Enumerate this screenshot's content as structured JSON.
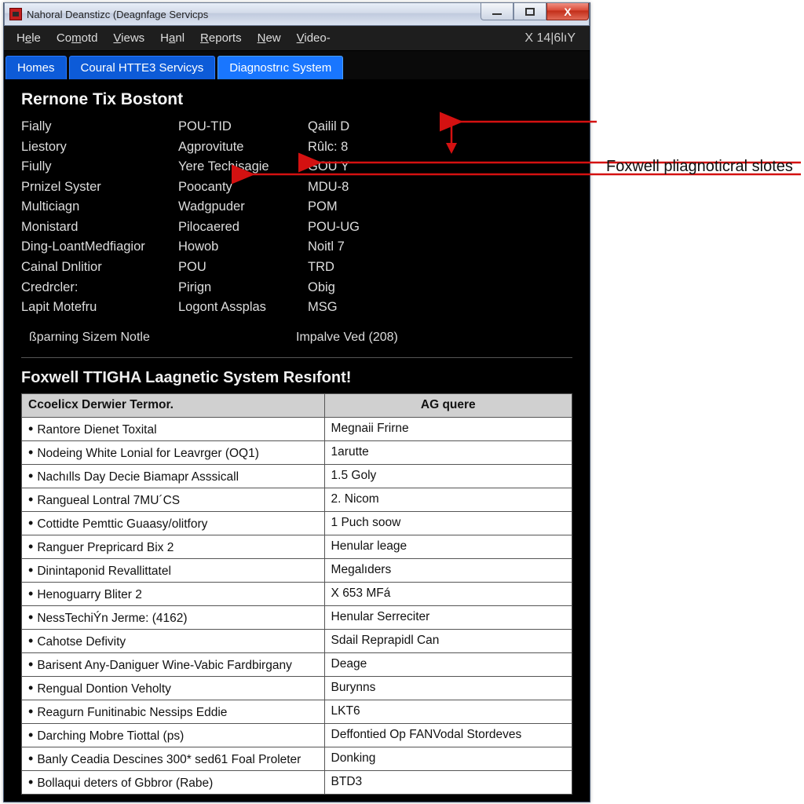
{
  "window": {
    "title": "Nahoral Deanstizc (Deagnfage Servicps"
  },
  "win_controls": {
    "min": "_",
    "max": "☐",
    "close": "X"
  },
  "menu": {
    "items": [
      {
        "pre": "H",
        "ul": "e",
        "post": "le"
      },
      {
        "pre": "Co",
        "ul": "m",
        "post": "otd"
      },
      {
        "pre": "",
        "ul": "V",
        "post": "iews"
      },
      {
        "pre": "H",
        "ul": "a",
        "post": "nl"
      },
      {
        "pre": "",
        "ul": "R",
        "post": "eports"
      },
      {
        "pre": "",
        "ul": "N",
        "post": "ew"
      },
      {
        "pre": "",
        "ul": "V",
        "post": "ideo-"
      }
    ],
    "right": "X  14|6lıY"
  },
  "tabs": [
    {
      "label": "Homes",
      "active": false
    },
    {
      "label": "Coural HTTE3 Servicys",
      "active": false
    },
    {
      "label": "Diagnostrıc System",
      "active": true
    }
  ],
  "section1": {
    "title": "Rernone Tix Bostont",
    "rows": [
      {
        "c1": "Fially",
        "c2": "POU-TID",
        "c3": "Qailil D"
      },
      {
        "c1": "Liestory",
        "c2": "Agprovitute",
        "c3": "Rûlc: 8"
      },
      {
        "c1": "Fiully",
        "c2": "Yere Techisagie",
        "c3": "GOU Y"
      },
      {
        "c1": "Prnizel Syster",
        "c2": "Poocanty",
        "c3": "MDU-8"
      },
      {
        "c1": "Multiciagn",
        "c2": "Wadgpuder",
        "c3": "POM"
      },
      {
        "c1": "Monistard",
        "c2": "Pilocaered",
        "c3": "POU-UG"
      },
      {
        "c1": "Ding-LoantMedfiagior",
        "c2": "Howob",
        "c3": "Noitl 7"
      },
      {
        "c1": "Cainal Dnlitior",
        "c2": "POU",
        "c3": "TRD"
      },
      {
        "c1": "Credrcler:",
        "c2": "Pirign",
        "c3": "Obig"
      },
      {
        "c1": "Lapit Motefru",
        "c2": "Logont Assplas",
        "c3": "MSG"
      }
    ],
    "footer_left": "ßparning Sizem Notle",
    "footer_right": "Impalve Ved (208)"
  },
  "section2": {
    "title": "Foxwell TTIGHA Laagnetic System Resıfont!",
    "headers": [
      "Ccoelicx Derwier Termor.",
      "AG quere"
    ],
    "rows": [
      {
        "a": "Rantore Dienet Toxital",
        "b": "Megnaii Frirne"
      },
      {
        "a": "Nodeing White Lonial for Leavrger (ОQ1)",
        "b": "1arutte"
      },
      {
        "a": "Nachılls Day Decie Biamapr Asssicall",
        "b": "1.5 Goly"
      },
      {
        "a": "Rangueal Lontral 7MU´CS",
        "b": "2. Nicom"
      },
      {
        "a": "Cottidte Pemttic Guaasy/olitfory",
        "b": "1 Puch soow"
      },
      {
        "a": "Ranguer Prepricard Bix 2",
        "b": "Henular leage"
      },
      {
        "a": "Dinintaponid Revallittatel",
        "b": "Megalıders"
      },
      {
        "a": "Henoguarry Bliter 2",
        "b": "X 653 MFá"
      },
      {
        "a": "NessTechiÝn Jerme: (4162)",
        "b": "Henular Serreciter"
      },
      {
        "a": "Cahotse Defivity",
        "b": "Sdail Reprapidl Can"
      },
      {
        "a": "Barisent Any-Daniguer Wine-Vabic Fardbirgany",
        "b": "Deage"
      },
      {
        "a": "Rengual Dontion Veholty",
        "b": "Burynns"
      },
      {
        "a": "Reagurn Funitinabic Nessips Eddie",
        "b": "LKT6"
      },
      {
        "a": "Darching Mobre Tiottal (ps)",
        "b": "Deffontied Op FANVodal Stordeves"
      },
      {
        "a": "Banly Ceadia Descines 300* sed61 Foal Proleter",
        "b": "Donking"
      },
      {
        "a": "Bollaqui deters of Gbbror (Rabe)",
        "b": "BTD3"
      }
    ]
  },
  "annotation": {
    "label": "Foxwell pliagnoticral slotes"
  }
}
